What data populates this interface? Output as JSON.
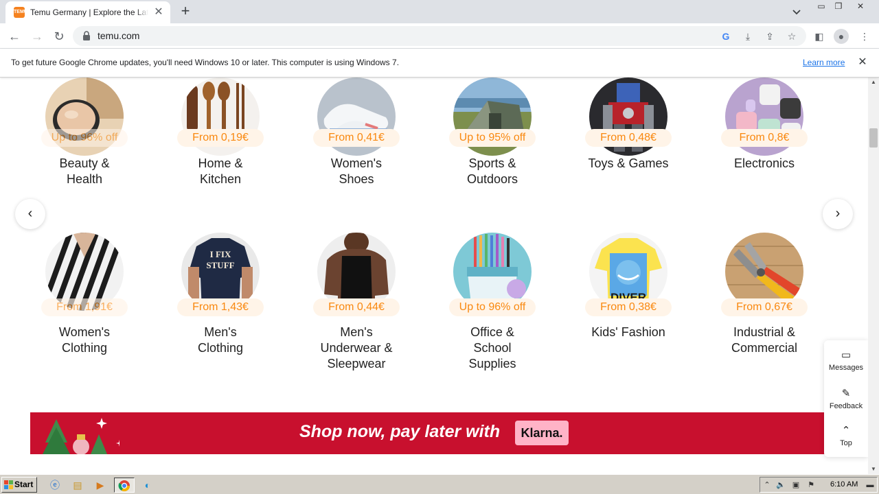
{
  "browser": {
    "tab_title": "Temu Germany | Explore the Latest Clothing, Beauty, Home, Jewelry & More",
    "favicon_text": "TEMU",
    "url": "temu.com"
  },
  "infobar": {
    "message": "To get future Google Chrome updates, you'll need Windows 10 or later. This computer is using Windows 7.",
    "link": "Learn more"
  },
  "categories": [
    {
      "name_line1": "Beauty &",
      "name_line2": "Health",
      "price": "Up to 96% off"
    },
    {
      "name_line1": "Home &",
      "name_line2": "Kitchen",
      "price": "From 0,19€"
    },
    {
      "name_line1": "Women's",
      "name_line2": "Shoes",
      "price": "From 0,41€"
    },
    {
      "name_line1": "Sports &",
      "name_line2": "Outdoors",
      "price": "Up to 95% off"
    },
    {
      "name_line1": "Toys & Games",
      "name_line2": "",
      "price": "From 0,48€"
    },
    {
      "name_line1": "Electronics",
      "name_line2": "",
      "price": "From 0,8€"
    },
    {
      "name_line1": "Women's",
      "name_line2": "Clothing",
      "name_line3": "",
      "price": "From 1,91€"
    },
    {
      "name_line1": "Men's",
      "name_line2": "Clothing",
      "name_line3": "",
      "price": "From 1,43€"
    },
    {
      "name_line1": "Men's",
      "name_line2": "Underwear &",
      "name_line3": "Sleepwear",
      "price": "From 0,44€"
    },
    {
      "name_line1": "Office &",
      "name_line2": "School",
      "name_line3": "Supplies",
      "price": "Up to 96% off"
    },
    {
      "name_line1": "Kids' Fashion",
      "name_line2": "",
      "name_line3": "",
      "price": "From 0,38€"
    },
    {
      "name_line1": "Industrial &",
      "name_line2": "Commercial",
      "name_line3": "",
      "price": "From 0,67€"
    }
  ],
  "images": {
    "shirt_text_1": "I FIX",
    "shirt_text_2": "STUFF",
    "kids_text": "DIVER"
  },
  "banner": {
    "text": "Shop now, pay later with",
    "klarna": "Klarna."
  },
  "side_panel": {
    "messages": "Messages",
    "feedback": "Feedback",
    "top": "Top"
  },
  "taskbar": {
    "start": "Start",
    "time": "6:10 AM"
  },
  "colors": {
    "price_orange": "#f9880f",
    "banner_red": "#c8102e",
    "klarna_pink": "#ffb3c7",
    "temu_orange": "#f58220"
  }
}
